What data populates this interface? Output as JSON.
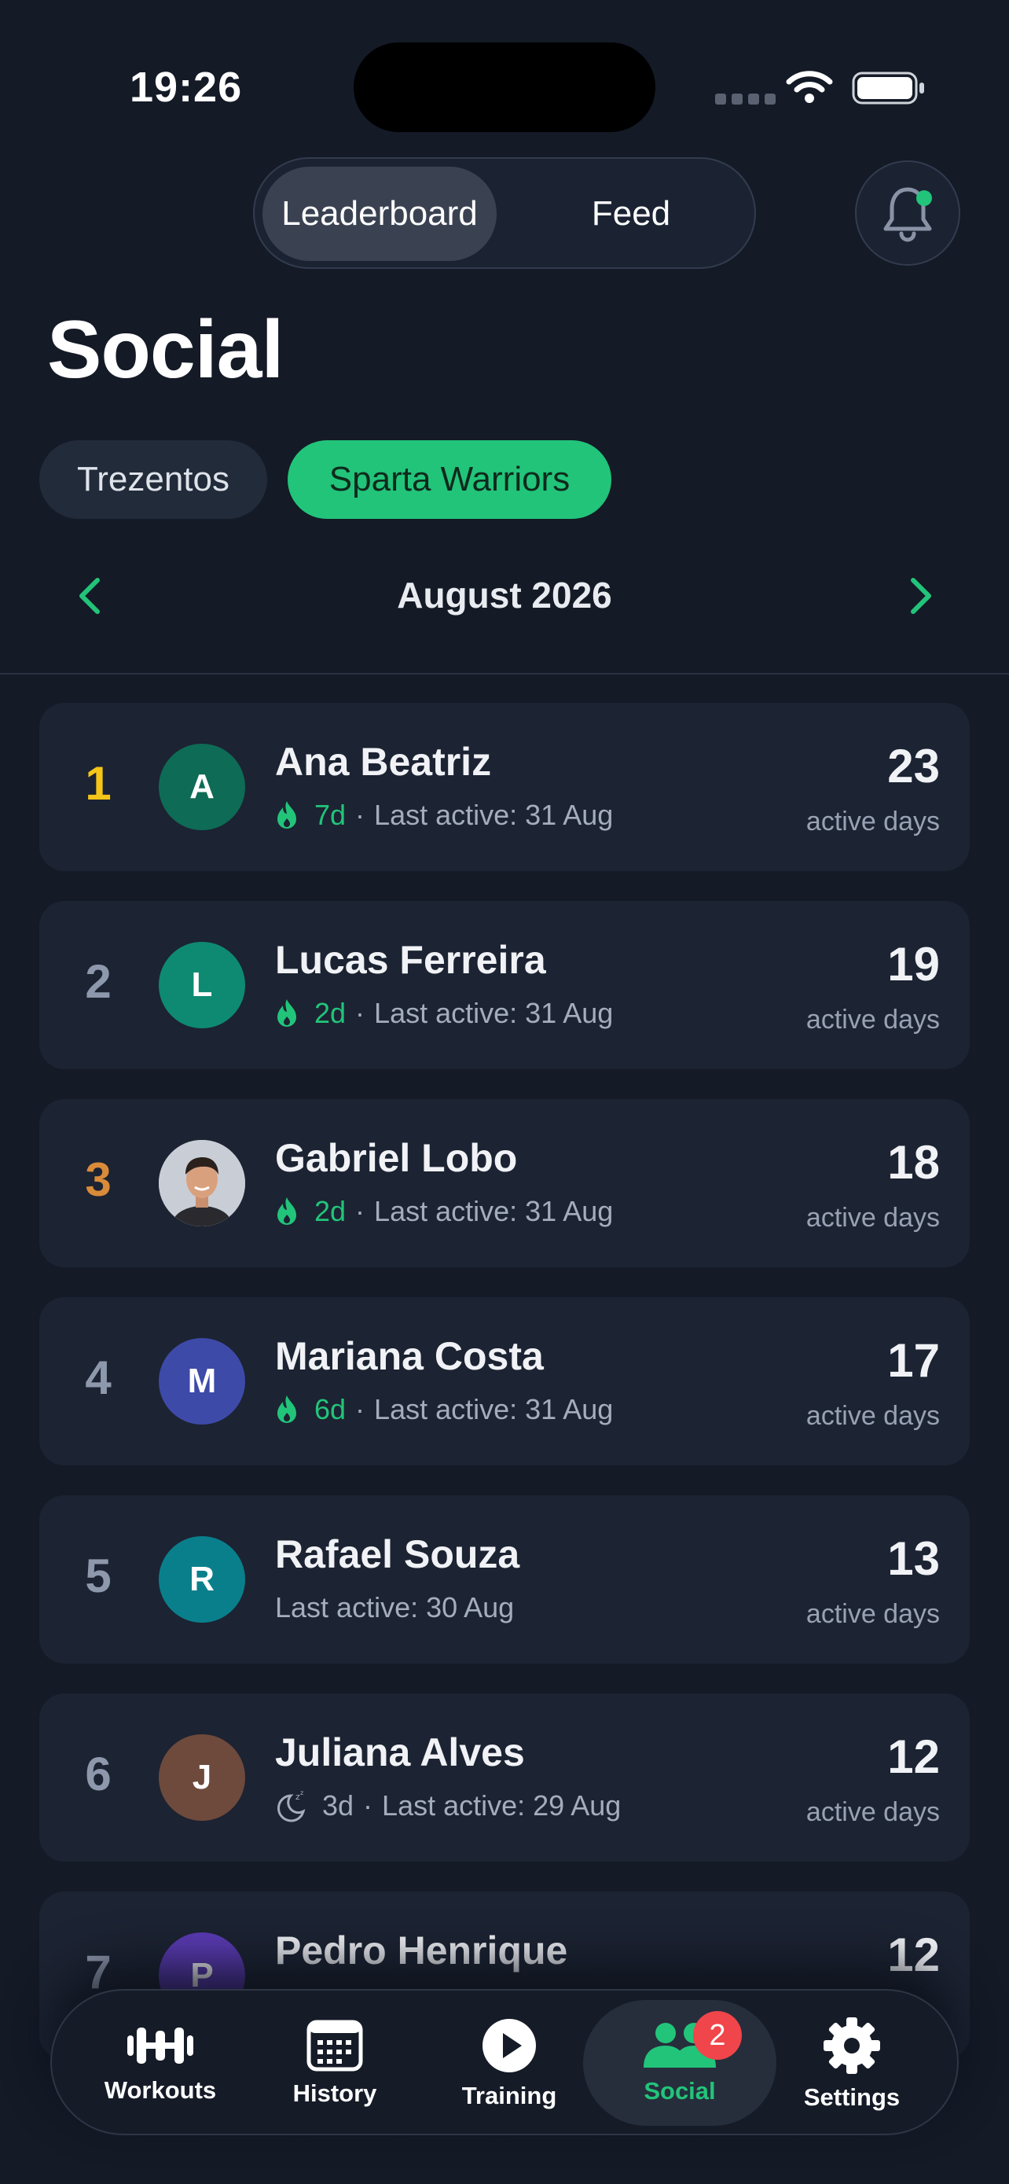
{
  "status_bar": {
    "time": "19:26"
  },
  "top_tabs": {
    "leaderboard": "Leaderboard",
    "feed": "Feed"
  },
  "page": {
    "title": "Social"
  },
  "groups": [
    "Trezentos",
    "Sparta Warriors"
  ],
  "month": {
    "label": "August 2026"
  },
  "accent_color": "#22c47a",
  "leaderboard": [
    {
      "rank": "1",
      "initial": "A",
      "avatar_color": "#0e6b55",
      "name": "Ana Beatriz",
      "streak_icon": "flame-icon",
      "streak": "7d",
      "last_active": "Last active: 31 Aug",
      "count": "23",
      "count_label": "active days"
    },
    {
      "rank": "2",
      "initial": "L",
      "avatar_color": "#0e8a72",
      "name": "Lucas Ferreira",
      "streak_icon": "flame-icon",
      "streak": "2d",
      "last_active": "Last active: 31 Aug",
      "count": "19",
      "count_label": "active days"
    },
    {
      "rank": "3",
      "initial": "",
      "avatar_color": "#c9ced6",
      "name": "Gabriel Lobo",
      "streak_icon": "flame-icon",
      "streak": "2d",
      "last_active": "Last active: 31 Aug",
      "count": "18",
      "count_label": "active days"
    },
    {
      "rank": "4",
      "initial": "M",
      "avatar_color": "#3d4aa8",
      "name": "Mariana Costa",
      "streak_icon": "flame-icon",
      "streak": "6d",
      "last_active": "Last active: 31 Aug",
      "count": "17",
      "count_label": "active days"
    },
    {
      "rank": "5",
      "initial": "R",
      "avatar_color": "#0a7f8c",
      "name": "Rafael Souza",
      "streak_icon": "",
      "streak": "",
      "last_active": "Last active: 30 Aug",
      "count": "13",
      "count_label": "active days"
    },
    {
      "rank": "6",
      "initial": "J",
      "avatar_color": "#6e4a3c",
      "name": "Juliana Alves",
      "streak_icon": "sleep-moon-icon",
      "streak": "3d",
      "last_active": "Last active: 29 Aug",
      "count": "12",
      "count_label": "active days"
    },
    {
      "rank": "7",
      "initial": "P",
      "avatar_color": "#5b3bb5",
      "name": "Pedro Henrique",
      "streak_icon": "",
      "streak": "",
      "last_active": "",
      "count": "12",
      "count_label": ""
    }
  ],
  "tab_bar": {
    "items": [
      {
        "label": "Workouts",
        "icon": "dumbbell-icon"
      },
      {
        "label": "History",
        "icon": "calendar-icon"
      },
      {
        "label": "Training",
        "icon": "play-icon"
      },
      {
        "label": "Social",
        "icon": "people-icon",
        "badge": "2"
      },
      {
        "label": "Settings",
        "icon": "gear-icon"
      }
    ]
  }
}
